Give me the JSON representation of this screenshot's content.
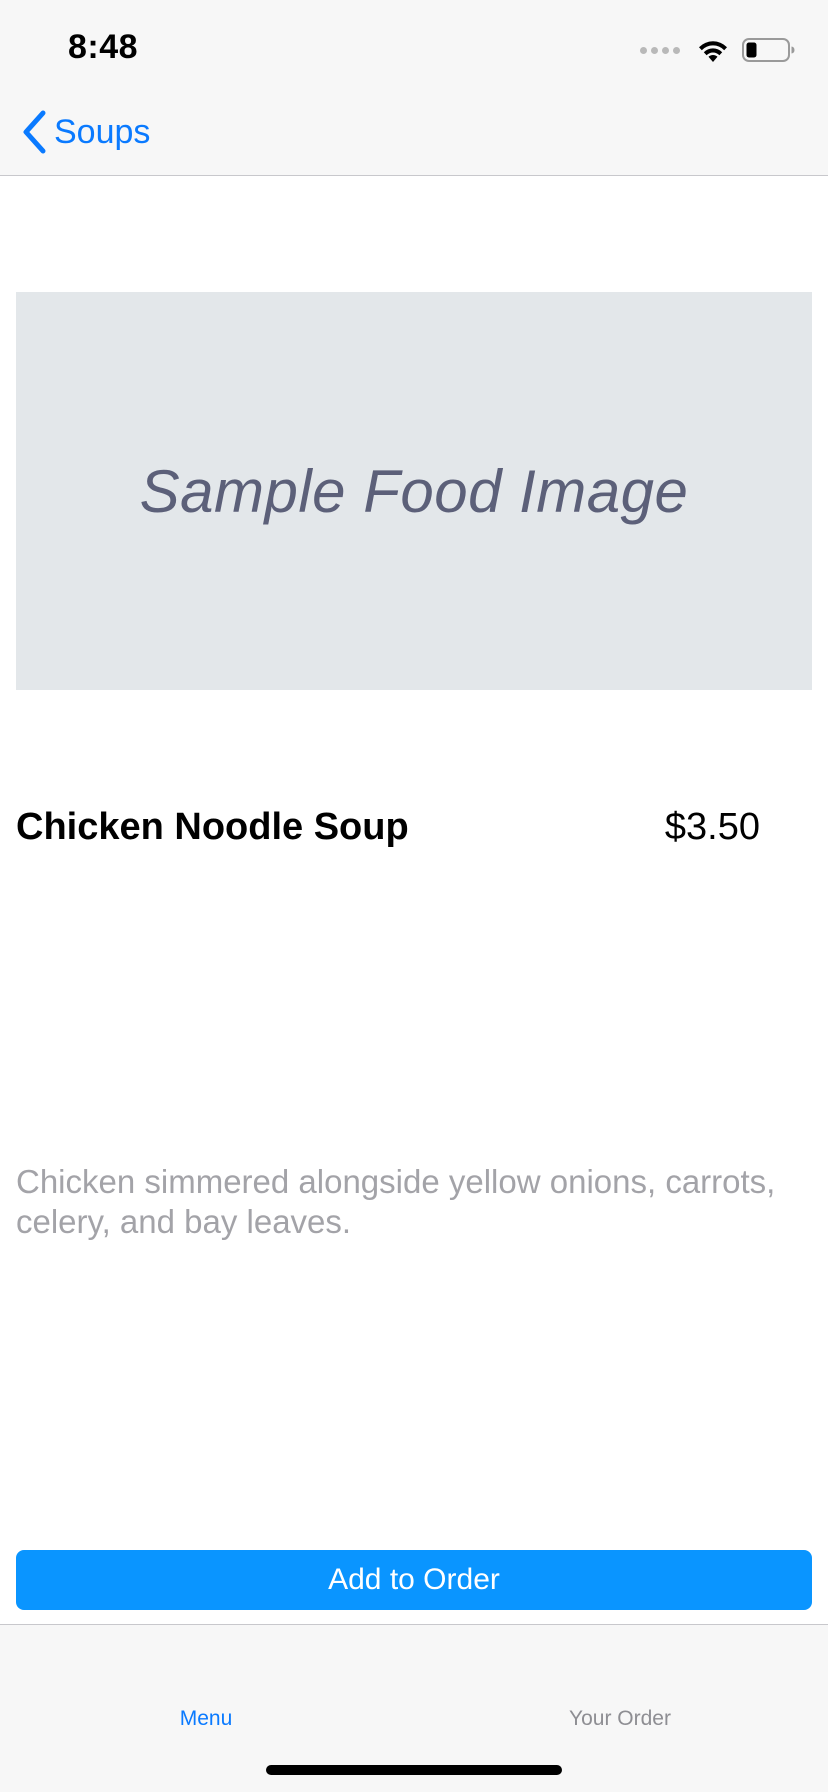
{
  "status_bar": {
    "time": "8:48"
  },
  "nav": {
    "back_label": "Soups"
  },
  "item": {
    "image_placeholder": "Sample Food Image",
    "name": "Chicken Noodle Soup",
    "price": "$3.50",
    "description": "Chicken simmered alongside yellow onions, carrots, celery, and bay leaves."
  },
  "actions": {
    "add_to_order": "Add to Order"
  },
  "tab_bar": {
    "tabs": [
      {
        "label": "Menu",
        "active": true
      },
      {
        "label": "Your Order",
        "active": false
      }
    ]
  },
  "colors": {
    "accent": "#0a7aff",
    "button": "#0a95ff",
    "placeholder_bg": "#e3e7ea",
    "placeholder_text": "#5c6079",
    "secondary_text": "#a3a3a8",
    "tab_inactive": "#8e8e93"
  },
  "icons": {
    "back": "chevron-left-icon",
    "signal": "cellular-signal-icon",
    "wifi": "wifi-icon",
    "battery": "battery-icon"
  }
}
